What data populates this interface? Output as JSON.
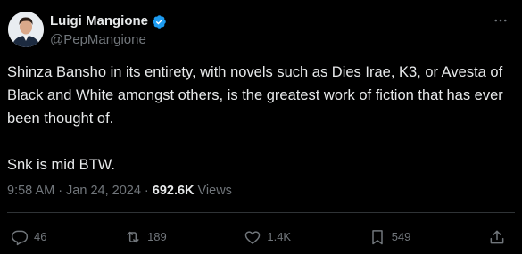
{
  "author": {
    "display_name": "Luigi Mangione",
    "handle": "@PepMangione",
    "verified_color": "#1d9bf0"
  },
  "post": {
    "text": "Shinza Bansho in its entirety, with novels such as Dies Irae, K3, or Avesta of Black and White amongst others, is the greatest work of fiction that has ever been thought of.\n\nSnk is mid BTW.",
    "time": "9:58 AM",
    "separator": "·",
    "date": "Jan 24, 2024",
    "views_count": "692.6K",
    "views_label": "Views"
  },
  "actions": {
    "replies": "46",
    "reposts": "189",
    "likes": "1.4K",
    "bookmarks": "549"
  },
  "icons": {
    "more": "more-horizontal-icon",
    "reply": "reply-icon",
    "repost": "repost-icon",
    "like": "heart-icon",
    "bookmark": "bookmark-icon",
    "share": "share-icon",
    "verified": "verified-badge-icon"
  },
  "colors": {
    "background": "#000000",
    "text_primary": "#e7e9ea",
    "text_secondary": "#71767b",
    "accent": "#1d9bf0",
    "divider": "#2f3336"
  }
}
